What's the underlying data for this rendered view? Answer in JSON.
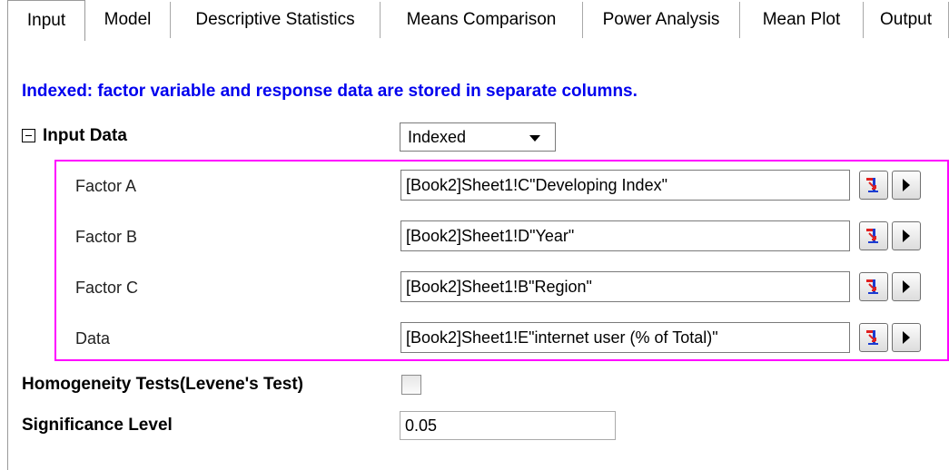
{
  "tabs": [
    {
      "label": "Input",
      "active": true
    },
    {
      "label": "Model"
    },
    {
      "label": "Descriptive Statistics"
    },
    {
      "label": "Means Comparison"
    },
    {
      "label": "Power Analysis"
    },
    {
      "label": "Mean Plot"
    },
    {
      "label": "Output"
    }
  ],
  "description": "Indexed: factor variable and response data are stored in separate columns.",
  "input_data": {
    "label": "Input Data",
    "mode_value": "Indexed",
    "rows": [
      {
        "label": "Factor A",
        "value": "[Book2]Sheet1!C\"Developing Index\""
      },
      {
        "label": "Factor B",
        "value": "[Book2]Sheet1!D\"Year\""
      },
      {
        "label": "Factor C",
        "value": "[Book2]Sheet1!B\"Region\""
      },
      {
        "label": "Data",
        "value": "[Book2]Sheet1!E\"internet user (% of Total)\""
      }
    ]
  },
  "homogeneity": {
    "label": "Homogeneity Tests(Levene's Test)",
    "checked": false
  },
  "significance": {
    "label": "Significance Level",
    "value": "0.05"
  },
  "colors": {
    "description": "#0000ee",
    "highlight": "#ff00ff",
    "range_icon_red": "#e02020",
    "range_icon_blue": "#1c3cd0"
  },
  "icons": {
    "collapse": "minus-box-icon",
    "range_select": "range-select-icon",
    "menu": "play-arrow-icon"
  }
}
